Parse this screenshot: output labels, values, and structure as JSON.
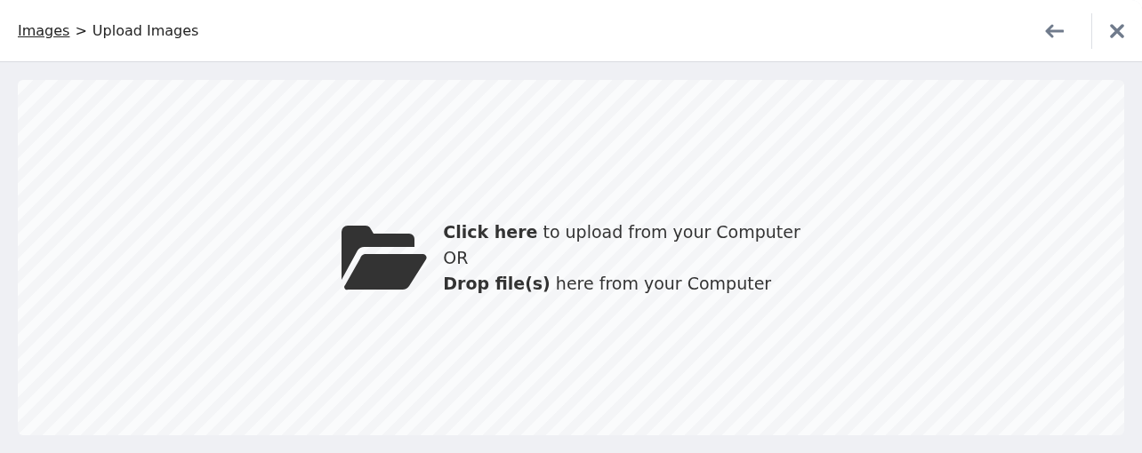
{
  "breadcrumb": {
    "link": "Images",
    "separator": ">",
    "current": "Upload Images"
  },
  "dropzone": {
    "lines": [
      "**Click here** to upload from your Computer",
      "OR",
      "**Drop file(s)** here from your Computer"
    ]
  }
}
